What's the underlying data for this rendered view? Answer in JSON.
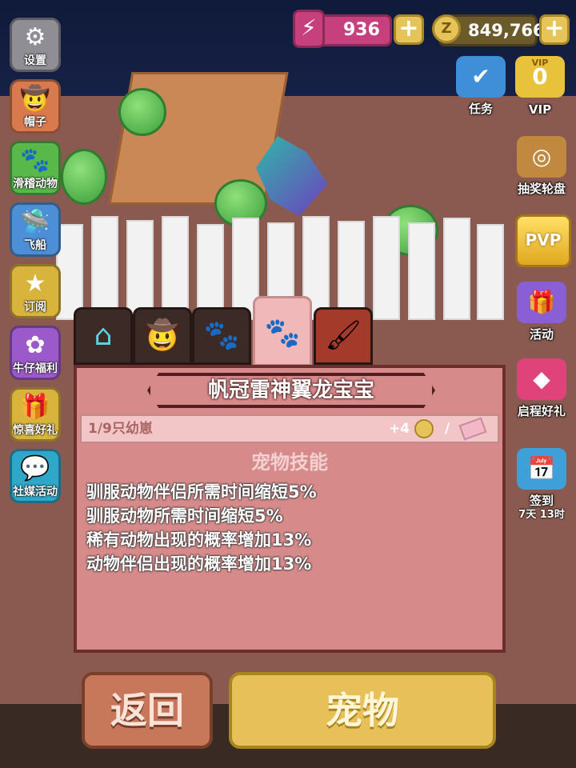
{
  "status_bar": {
    "energy_value": "936",
    "coins_value": "849,766",
    "plus_symbol": "+"
  },
  "left_menu": [
    {
      "label": "设置",
      "icon": "gear-icon",
      "glyph": "⚙",
      "color": "#8e8e94"
    },
    {
      "label": "帽子",
      "icon": "hat-icon",
      "glyph": "🤠",
      "color": "#d9794e"
    },
    {
      "label": "滑稽动物",
      "icon": "paw-icon",
      "glyph": "🐾",
      "color": "#58b84a"
    },
    {
      "label": "飞船",
      "icon": "spaceship-icon",
      "glyph": "🛸",
      "color": "#4d8fd6"
    },
    {
      "label": "订阅",
      "icon": "star-badge-icon",
      "glyph": "★",
      "color": "#d9b43c"
    },
    {
      "label": "牛仔福利",
      "icon": "flower-icon",
      "glyph": "✿",
      "color": "#9b59c9"
    },
    {
      "label": "惊喜好礼",
      "icon": "gift-icon",
      "glyph": "🎁",
      "color": "#d9b43c"
    },
    {
      "label": "社媒活动",
      "icon": "chat-icon",
      "glyph": "💬",
      "color": "#2fa7c9"
    }
  ],
  "right_menu": [
    {
      "label": "任务",
      "icon": "checklist-icon",
      "glyph": "✔",
      "color": "#3f8fd8"
    },
    {
      "label": "VIP",
      "icon": "vip-badge-icon",
      "glyph": "0",
      "color": "#e8c23a"
    },
    {
      "label": "抽奖轮盘",
      "icon": "wheel-icon",
      "glyph": "◎",
      "color": "#c0893f"
    },
    {
      "label": "活动",
      "icon": "gift-box-icon",
      "glyph": "🎁",
      "color": "#8a5fd6"
    },
    {
      "label": "启程好礼",
      "icon": "coins-icon",
      "glyph": "◆",
      "color": "#e0427a"
    },
    {
      "label": "签到",
      "icon": "calendar-icon",
      "glyph": "📅",
      "color": "#3f9fd8"
    }
  ],
  "pvp_label": "PVP",
  "vip_header": "VIP",
  "signin_timer": "7天 13时",
  "tabs": [
    {
      "name": "house",
      "icon": "house-icon",
      "glyph": "⌂"
    },
    {
      "name": "hat",
      "icon": "hat-icon",
      "glyph": "🤠"
    },
    {
      "name": "paw",
      "icon": "paw-icon",
      "glyph": "🐾"
    },
    {
      "name": "pet",
      "icon": "paw-pet-icon",
      "glyph": "🐾"
    },
    {
      "name": "paint",
      "icon": "paint-roller-icon",
      "glyph": "🖌"
    }
  ],
  "panel": {
    "title": "帆冠雷神翼龙宝宝",
    "progress": "1/9只幼崽",
    "reward": "+4",
    "skills_title": "宠物技能",
    "skills": [
      "驯服动物伴侣所需时间缩短5%",
      "驯服动物所需时间缩短5%",
      "稀有动物出现的概率增加13%",
      "动物伴侣出现的概率增加13%"
    ]
  },
  "buttons": {
    "back": "返回",
    "pet": "宠物"
  },
  "colors": {
    "panel_bg": "#d68a8a",
    "panel_border": "#6b2d2d",
    "back_btn": "#c8785a",
    "pet_btn": "#e8c05a"
  }
}
